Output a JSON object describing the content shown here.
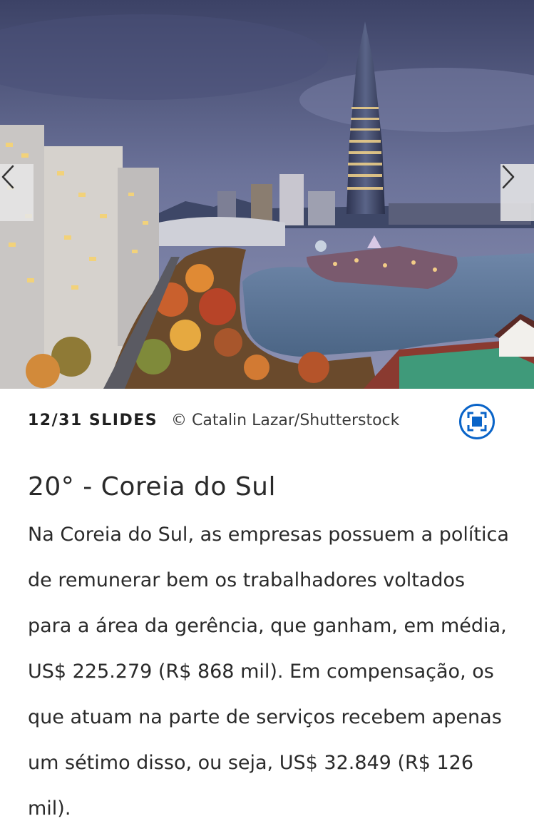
{
  "slideshow": {
    "counter": "12/31 SLIDES",
    "credit": "© Catalin Lazar/Shutterstock",
    "prev_icon": "chevron-left-icon",
    "next_icon": "chevron-right-icon",
    "fullscreen_icon": "fullscreen-icon",
    "accent_color": "#0a64c8"
  },
  "slide": {
    "title": "20° - Coreia do Sul",
    "body": "Na Coreia do Sul, as empresas possuem a política de remunerar bem os trabalhadores voltados para a área da gerência, que ganham, em média, US$ 225.279 (R$ 868 mil). Em compensação, os que atuam na parte de serviços recebem apenas um sétimo disso, ou seja, US$ 32.849 (R$ 126 mil)."
  }
}
